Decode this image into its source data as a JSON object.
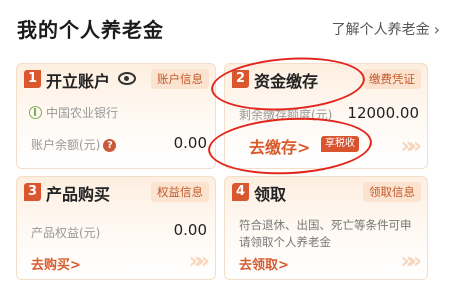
{
  "header": {
    "title": "我的个人养老金",
    "learn_more": "了解个人养老金",
    "learn_more_chevron": "›"
  },
  "cards": {
    "account": {
      "number": "1",
      "title": "开立账户",
      "tag": "账户信息",
      "bank": "中国农业银行",
      "balance_label": "账户余额(元)",
      "balance_help": "?",
      "balance_value": "0.00"
    },
    "deposit": {
      "number": "2",
      "title": "资金缴存",
      "tag": "缴费凭证",
      "remaining_label": "剩余缴存额度(元)",
      "remaining_value": "12000.00",
      "action": "去缴存>",
      "action_badge": "享税收"
    },
    "purchase": {
      "number": "3",
      "title": "产品购买",
      "tag": "权益信息",
      "equity_label": "产品权益(元)",
      "equity_value": "0.00",
      "action": "去购买>"
    },
    "withdraw": {
      "number": "4",
      "title": "领取",
      "tag": "领取信息",
      "description": "符合退休、出国、死亡等条件可申请领取个人养老金",
      "action": "去领取>"
    }
  },
  "decorations": {
    "chevrons": "»»"
  },
  "colors": {
    "accent": "#d9562e",
    "annotation_circle": "#e1261c"
  }
}
